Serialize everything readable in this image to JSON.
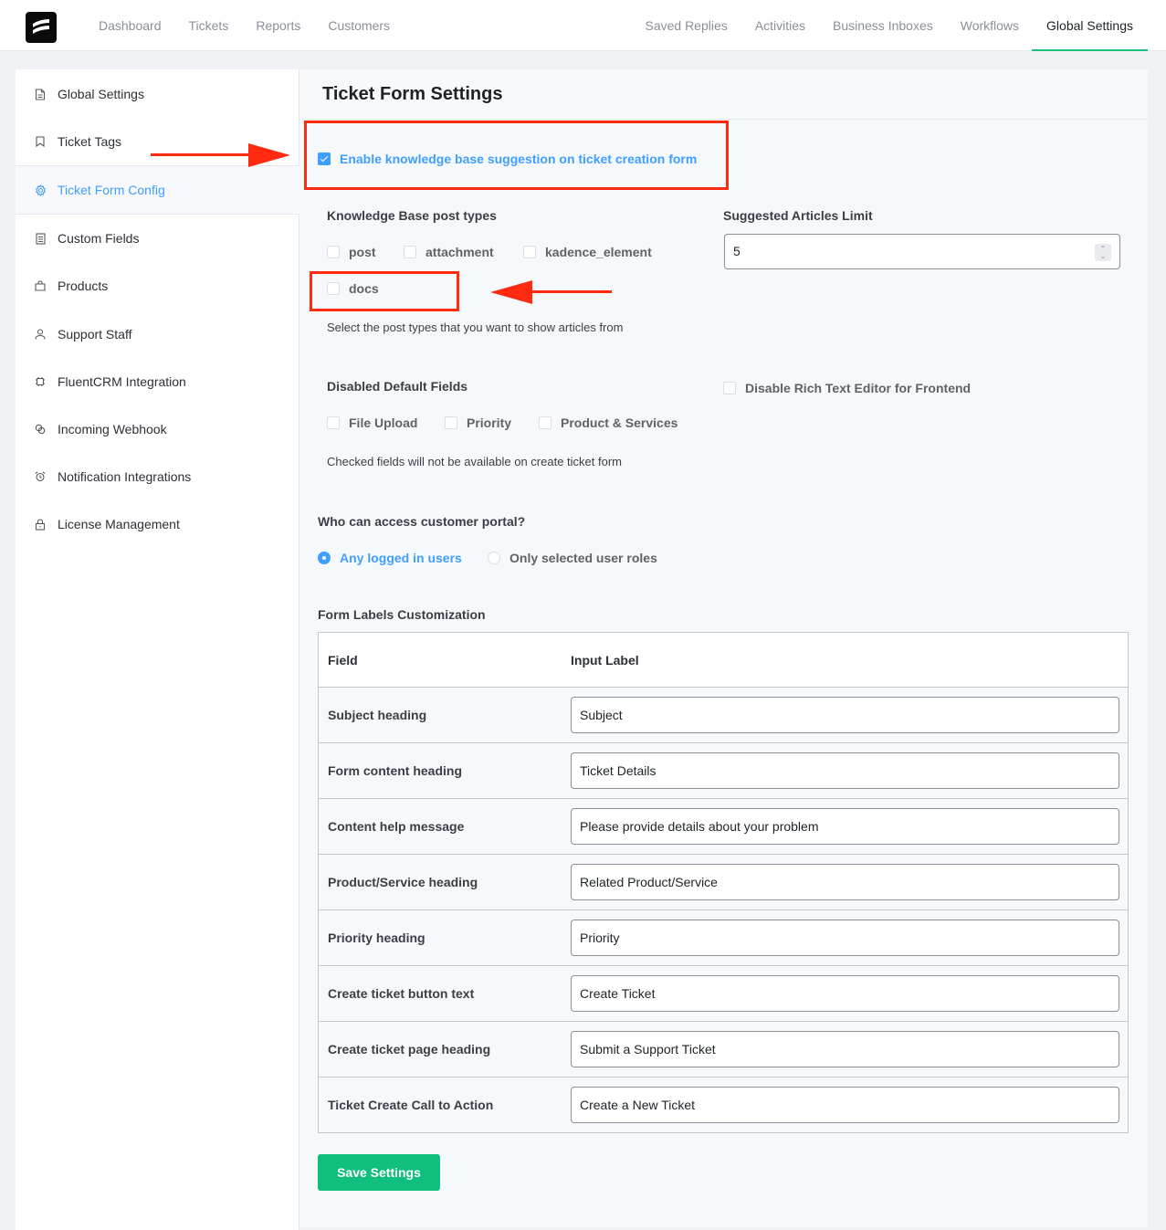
{
  "app": {
    "logo_icon": "fluent-support-logo-icon",
    "nav_left": [
      {
        "label": "Dashboard"
      },
      {
        "label": "Tickets"
      },
      {
        "label": "Reports"
      },
      {
        "label": "Customers"
      }
    ],
    "nav_right": [
      {
        "label": "Saved Replies"
      },
      {
        "label": "Activities"
      },
      {
        "label": "Business Inboxes"
      },
      {
        "label": "Workflows"
      },
      {
        "label": "Global Settings",
        "active": true
      }
    ],
    "accent_color": "#1fbf7d"
  },
  "sidebar": {
    "items": [
      {
        "label": "Global Settings",
        "icon": "document-icon"
      },
      {
        "label": "Ticket Tags",
        "icon": "bookmark-icon"
      },
      {
        "label": "Ticket Form Config",
        "icon": "gear-icon",
        "active": true
      },
      {
        "label": "Custom Fields",
        "icon": "list-document-icon"
      },
      {
        "label": "Products",
        "icon": "shopping-bag-icon"
      },
      {
        "label": "Support Staff",
        "icon": "user-icon"
      },
      {
        "label": "FluentCRM Integration",
        "icon": "chip-icon"
      },
      {
        "label": "Incoming Webhook",
        "icon": "webhook-icon"
      },
      {
        "label": "Notification Integrations",
        "icon": "alarm-clock-icon"
      },
      {
        "label": "License Management",
        "icon": "lock-icon"
      }
    ]
  },
  "main": {
    "title": "Ticket Form Settings",
    "kb_suggestion": {
      "label": "Enable knowledge base suggestion on ticket creation form",
      "checked": true
    },
    "kb_post_types": {
      "label": "Knowledge Base post types",
      "options": [
        {
          "label": "post",
          "checked": false
        },
        {
          "label": "attachment",
          "checked": false
        },
        {
          "label": "kadence_element",
          "checked": false
        },
        {
          "label": "docs",
          "checked": false
        }
      ],
      "help": "Select the post types that you want to show articles from"
    },
    "suggested_limit": {
      "label": "Suggested Articles Limit",
      "value": "5"
    },
    "disabled_fields": {
      "label": "Disabled Default Fields",
      "options": [
        {
          "label": "File Upload",
          "checked": false
        },
        {
          "label": "Priority",
          "checked": false
        },
        {
          "label": "Product & Services",
          "checked": false
        }
      ],
      "help": "Checked fields will not be available on create ticket form"
    },
    "rich_text": {
      "label": "Disable Rich Text Editor for Frontend",
      "checked": false
    },
    "portal_access": {
      "label": "Who can access customer portal?",
      "options": [
        {
          "label": "Any logged in users",
          "selected": true
        },
        {
          "label": "Only selected user roles",
          "selected": false
        }
      ]
    },
    "form_labels": {
      "label": "Form Labels Customization",
      "columns": [
        "Field",
        "Input Label"
      ],
      "rows": [
        {
          "field": "Subject heading",
          "value": "Subject"
        },
        {
          "field": "Form content heading",
          "value": "Ticket Details"
        },
        {
          "field": "Content help message",
          "value": "Please provide details about your problem"
        },
        {
          "field": "Product/Service heading",
          "value": "Related Product/Service"
        },
        {
          "field": "Priority heading",
          "value": "Priority"
        },
        {
          "field": "Create ticket button text",
          "value": "Create Ticket"
        },
        {
          "field": "Create ticket page heading",
          "value": "Submit a Support Ticket"
        },
        {
          "field": "Ticket Create Call to Action",
          "value": "Create a New Ticket"
        }
      ]
    },
    "save_label": "Save Settings",
    "save_color": "#10bf7e",
    "annotation_color": "#ff2a0f"
  }
}
